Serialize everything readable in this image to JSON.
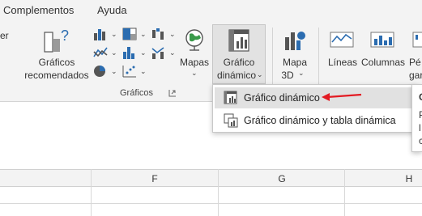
{
  "tabs": {
    "left_fragment": "er",
    "complementos": "Complementos",
    "ayuda": "Ayuda"
  },
  "ribbon": {
    "recomendados_line1": "Gráficos",
    "recomendados_line2": "recomendados",
    "mapas": "Mapas",
    "pivot_line1": "Gráfico",
    "pivot_line2": "dinámico",
    "mapa3d_line1": "Mapa",
    "mapa3d_line2": "3D",
    "lineas": "Líneas",
    "columnas": "Columnas",
    "perdidas_fragment_1": "Pé",
    "perdidas_fragment_2": "gar",
    "group_label": "Gráficos"
  },
  "dropdown": {
    "item1": "Gráfico dinámico",
    "item2": "Gráfico dinámico y tabla dinámica"
  },
  "tooltip": {
    "line1": "G",
    "line2": "P",
    "line3": "l",
    "line4": "c"
  },
  "grid": {
    "col_f": "F",
    "col_g": "G",
    "col_h": "H"
  },
  "colors": {
    "arrow": "#e31b23",
    "accent": "#2b6cb0"
  }
}
